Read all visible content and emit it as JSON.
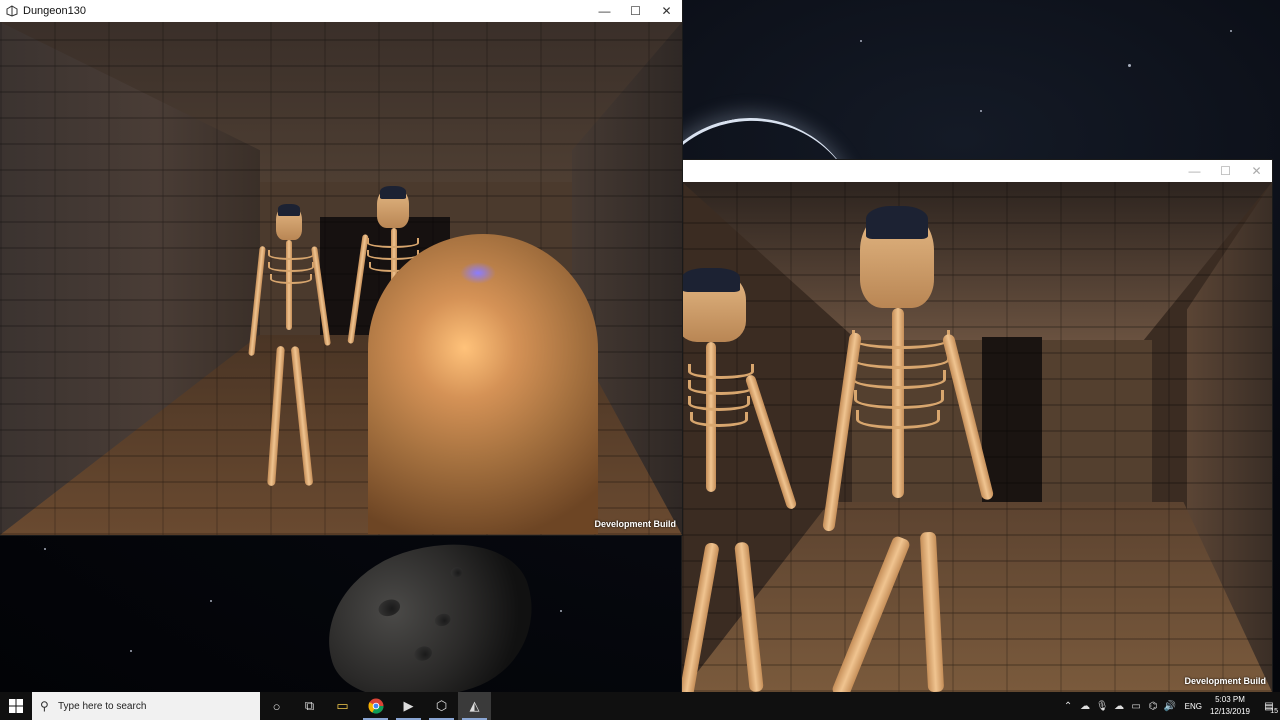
{
  "windows": {
    "left": {
      "title": "Dungeon130",
      "minimize": "—",
      "maximize": "☐",
      "close": "✕",
      "overlay_label": "Development Build"
    },
    "right": {
      "title": "",
      "minimize": "—",
      "maximize": "☐",
      "close": "✕",
      "overlay_label": "Development Build"
    }
  },
  "taskbar": {
    "search_placeholder": "Type here to search",
    "apps": [
      {
        "name": "cortana-icon",
        "glyph": "○"
      },
      {
        "name": "task-view-icon",
        "glyph": "⧉"
      },
      {
        "name": "file-explorer-icon",
        "glyph": "📁"
      },
      {
        "name": "chrome-icon",
        "glyph": "◉"
      },
      {
        "name": "visual-studio-icon",
        "glyph": "▶"
      },
      {
        "name": "unity-hub-icon",
        "glyph": "⬡"
      },
      {
        "name": "unity-icon",
        "glyph": "◭"
      }
    ],
    "tray": {
      "language": "ENG",
      "time": "5:03 PM",
      "date": "12/13/2019",
      "notification_count": "15"
    }
  }
}
